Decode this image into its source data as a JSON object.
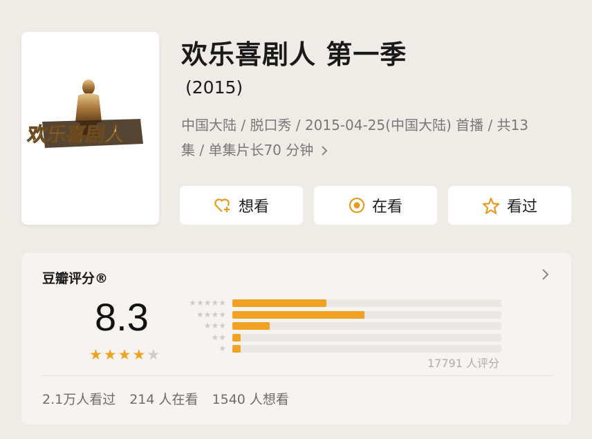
{
  "show": {
    "title": "欢乐喜剧人 第一季",
    "year": "(2015)",
    "meta_line1": "中国大陆 / 脱口秀 / 2015-04-25(中国大陆) 首播 / 共13",
    "meta_line2": "集 / 单集片长70 分钟",
    "poster_logo_text": "欢乐喜剧人"
  },
  "actions": {
    "want_label": "想看",
    "doing_label": "在看",
    "done_label": "看过"
  },
  "rating": {
    "title": "豆瓣评分®",
    "score": "8.3",
    "stars_filled": 4,
    "stars_total": 5,
    "count_text": "17791 人评分",
    "distribution": [
      {
        "stars": 5,
        "fraction": 0.35
      },
      {
        "stars": 4,
        "fraction": 0.49
      },
      {
        "stars": 3,
        "fraction": 0.14
      },
      {
        "stars": 2,
        "fraction": 0.03
      },
      {
        "stars": 1,
        "fraction": 0.03
      }
    ]
  },
  "stats": {
    "watched": "2.1万人看过",
    "watching": "214 人在看",
    "wanted": "1540 人想看"
  },
  "colors": {
    "accent": "#f0a224",
    "background": "#efebe6",
    "card": "#f6f3f0"
  }
}
